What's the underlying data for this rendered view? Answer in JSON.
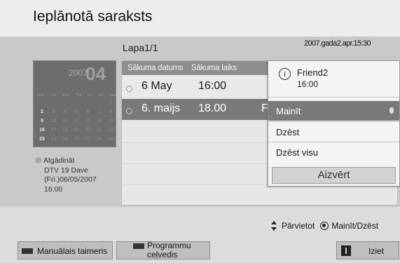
{
  "header": {
    "title": "Ieplānotā saraksts"
  },
  "page_indicator": "Lapa1/1",
  "datetime": "2007.gada2.apr.15:30",
  "calendar": {
    "year": "2007",
    "month": "04",
    "weekdays": [
      "Mon",
      "Tue",
      "Wed",
      "Thu",
      "Fri",
      "Sat",
      "Sun"
    ],
    "weeks": [
      [
        "",
        "",
        "",
        "",
        "",
        "",
        "1"
      ],
      [
        "2",
        "3",
        "4",
        "5",
        "6",
        "7",
        "8"
      ],
      [
        "9",
        "10",
        "11",
        "12",
        "13",
        "14",
        "15"
      ],
      [
        "16",
        "17",
        "18",
        "19",
        "20",
        "21",
        "22"
      ],
      [
        "23",
        "24",
        "25",
        "26",
        "27",
        "28",
        "29"
      ]
    ]
  },
  "reminder": {
    "label": "Atgādināt",
    "channel": "DTV 19 Dave",
    "date": "(Fri.)06/05/2007",
    "time": "16:00"
  },
  "list": {
    "columns": {
      "start_date": "Sākuma datums",
      "start_time": "Sākuma laiks"
    },
    "rows": [
      {
        "date": "6 May",
        "time": "16:00",
        "extra": ""
      },
      {
        "date": "6. maijs",
        "time": "18.00",
        "extra": "F"
      }
    ]
  },
  "popup": {
    "program_name": "Friend2",
    "program_time": "16:00",
    "menu": [
      "Mainīt",
      "Dzēst",
      "Dzēst visu"
    ],
    "close_label": "Aizvērt"
  },
  "nav_hint": {
    "move": "Pārvietot",
    "action": "Mainīt/Dzēst"
  },
  "footer": {
    "manual_timer": "Manuālais taimeris",
    "program_guide": "Programmu ceļvedis",
    "exit": "Iziet"
  },
  "colors": {
    "highlight": "#7a7a7a",
    "background": "#c9c9c9"
  }
}
